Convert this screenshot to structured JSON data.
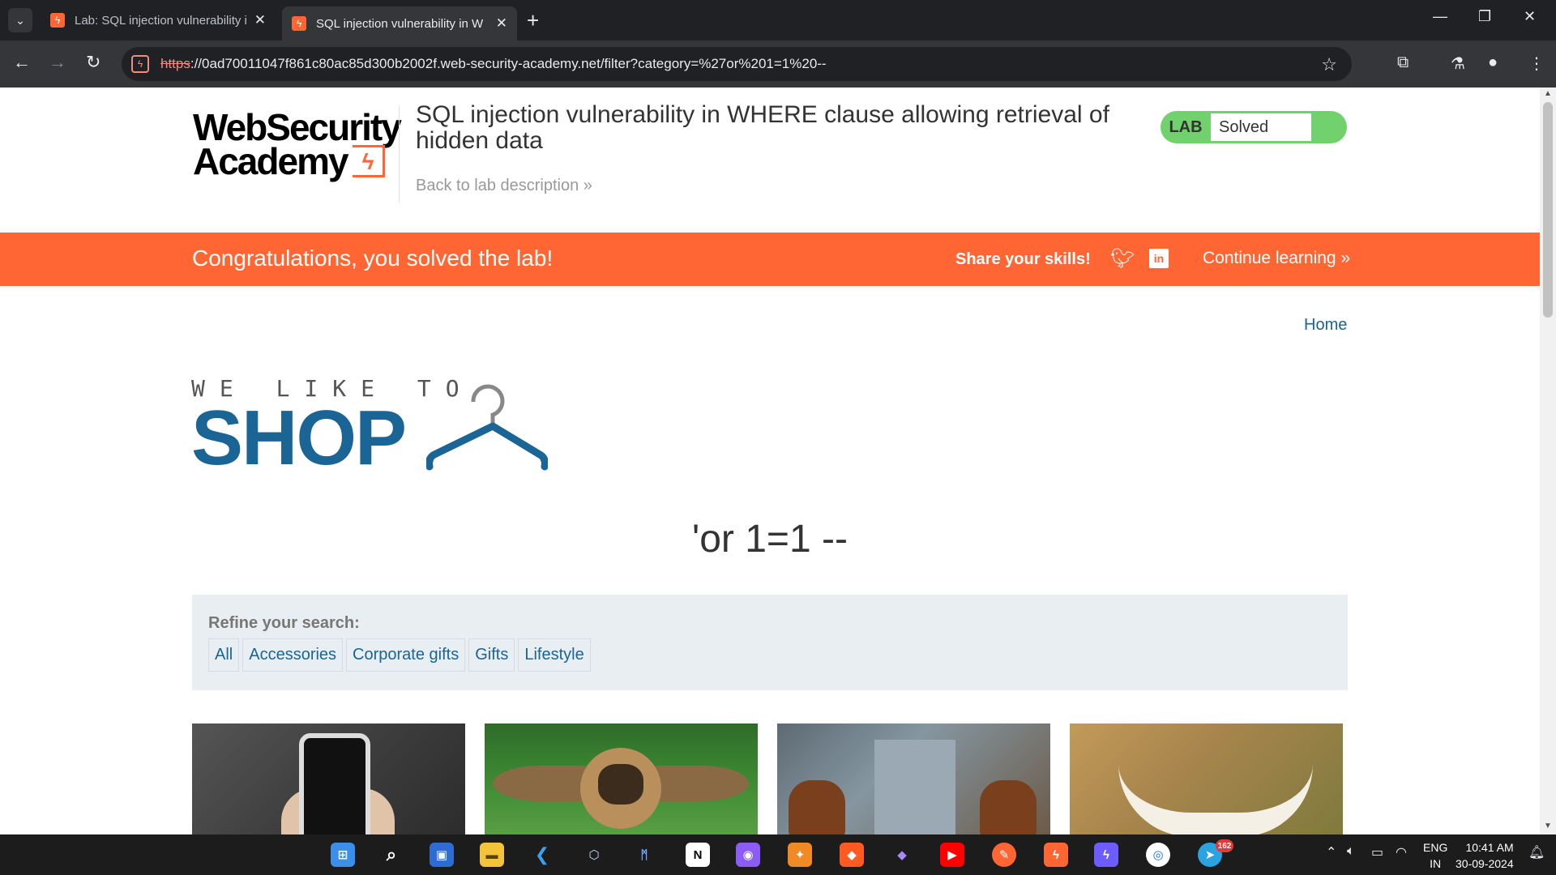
{
  "browser": {
    "tabs": [
      {
        "title": "Lab: SQL injection vulnerability i",
        "active": false
      },
      {
        "title": "SQL injection vulnerability in W",
        "active": true
      }
    ],
    "url_scheme": "https",
    "url_rest": "://0ad70011047f861c80ac85d300b2002f.web-security-academy.net/filter?category=%27or%201=1%20--",
    "accent": "#ff6633"
  },
  "header": {
    "logo_line1": "WebSecurity",
    "logo_line2": "Academy",
    "lab_title": "SQL injection vulnerability in WHERE clause allowing retrieval of hidden data",
    "back_link": "Back to lab description",
    "back_chevron": "»",
    "lab_badge": "LAB",
    "lab_state": "Solved",
    "status_color": "#70d16d"
  },
  "banner": {
    "message": "Congratulations, you solved the lab!",
    "share": "Share your skills!",
    "continue": "Continue learning",
    "continue_chevron": "»",
    "color": "#ff6633"
  },
  "shop": {
    "home_link": "Home",
    "logo_top": "WE LIKE TO",
    "logo_main": "SHOP",
    "search_title": "'or 1=1 --",
    "refine_label": "Refine your search:",
    "filters": [
      "All",
      "Accessories",
      "Corporate gifts",
      "Gifts",
      "Lifestyle"
    ]
  },
  "taskbar": {
    "lang_top": "ENG",
    "lang_bottom": "IN",
    "time": "10:41 AM",
    "date": "30-09-2024",
    "badge": "162"
  }
}
